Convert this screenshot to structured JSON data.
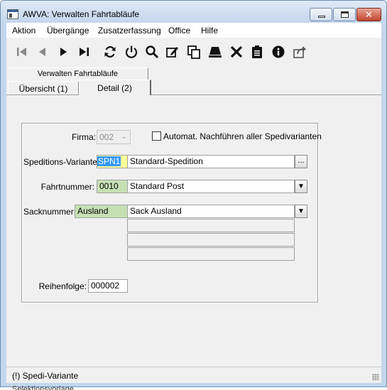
{
  "window": {
    "title": "AWVA: Verwalten Fahrtabläufe",
    "icon": "app-window-icon",
    "controls": {
      "minimize": "minimize-icon",
      "maximize": "maximize-icon",
      "close": "✕"
    }
  },
  "menu": {
    "items": [
      {
        "label": "Aktion"
      },
      {
        "label": "Übergänge"
      },
      {
        "label": "Zusatzerfassung"
      },
      {
        "label": "Office"
      },
      {
        "label": "Hilfe"
      }
    ]
  },
  "toolbar": {
    "buttons": [
      "first-record-icon",
      "previous-record-icon",
      "next-record-icon",
      "last-record-icon",
      "refresh-icon",
      "power-icon",
      "search-icon",
      "edit-icon",
      "copy-icon",
      "save-icon",
      "delete-icon",
      "clipboard-icon",
      "info-icon",
      "export-icon"
    ]
  },
  "tabs": {
    "outer": "Verwalten Fahrtabläufe",
    "sub": [
      "Übersicht (1)",
      "Detail (2)"
    ],
    "active": "Detail (2)"
  },
  "form": {
    "firma_label": "Firma:",
    "firma_value": "002",
    "auto_label": "Automat. Nachführen aller Spedivarianten",
    "auto_checked": false,
    "speditions_label": "Speditions-Variante:",
    "speditions_code": "SPN1",
    "speditions_name": "Standard-Spedition",
    "speditions_button": "...",
    "fahrt_label": "Fahrtnummer:",
    "fahrt_code": "0010",
    "fahrt_name": "Standard Post",
    "sack_label": "Sacknummer:",
    "sack_code": "Ausland",
    "sack_name": "Sack Ausland",
    "sack_extra_lines": [
      "",
      "",
      ""
    ],
    "reihenfolge_label": "Reihenfolge:",
    "reihenfolge_value": "000002"
  },
  "status": {
    "text": "(!) Spedi-Variante"
  },
  "below_window_text": "Selektionsvorlage"
}
